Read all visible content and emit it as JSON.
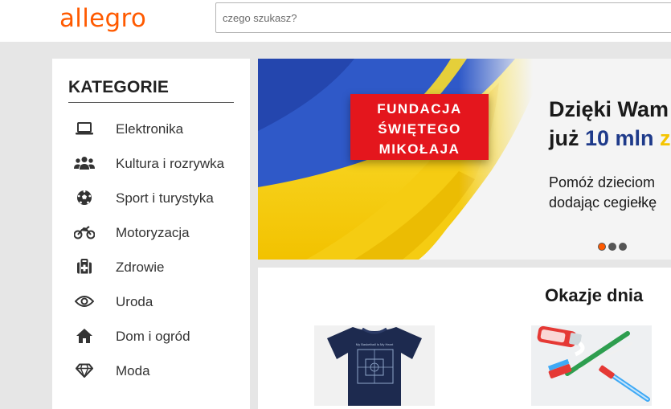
{
  "header": {
    "logo": "allegro",
    "search_placeholder": "czego szukasz?"
  },
  "sidebar": {
    "title": "KATEGORIE",
    "items": [
      {
        "label": "Elektronika",
        "icon": "laptop-icon"
      },
      {
        "label": "Kultura i rozrywka",
        "icon": "people-icon"
      },
      {
        "label": "Sport i turystyka",
        "icon": "football-icon"
      },
      {
        "label": "Motoryzacja",
        "icon": "motorcycle-icon"
      },
      {
        "label": "Zdrowie",
        "icon": "first-aid-kit-icon"
      },
      {
        "label": "Uroda",
        "icon": "eye-icon"
      },
      {
        "label": "Dom i ogród",
        "icon": "home-icon"
      },
      {
        "label": "Moda",
        "icon": "diamond-icon"
      }
    ]
  },
  "banner": {
    "badge_lines": [
      "FUNDACJA",
      "ŚWIĘTEGO",
      "MIKOŁAJA"
    ],
    "headline_line1": "Dzięki Wam",
    "headline_line2_prefix": "już ",
    "headline_line2_amount": "10 mln",
    "headline_line2_suffix": " z",
    "subtext_line1": "Pomóż dzieciom",
    "subtext_line2": "dodając cegiełkę",
    "slides_total": 3,
    "active_slide": 1
  },
  "deals": {
    "title": "Okazje dnia",
    "products": [
      {
        "image": "navy-tshirt",
        "printed_text": "My Basketball Is My Heart"
      },
      {
        "image": "toothbrushes"
      }
    ]
  },
  "colors": {
    "brand": "#ff5a00",
    "badge_red": "#e4161d",
    "flag_blue": "#2f59c8",
    "flag_yellow": "#f7d10a"
  }
}
